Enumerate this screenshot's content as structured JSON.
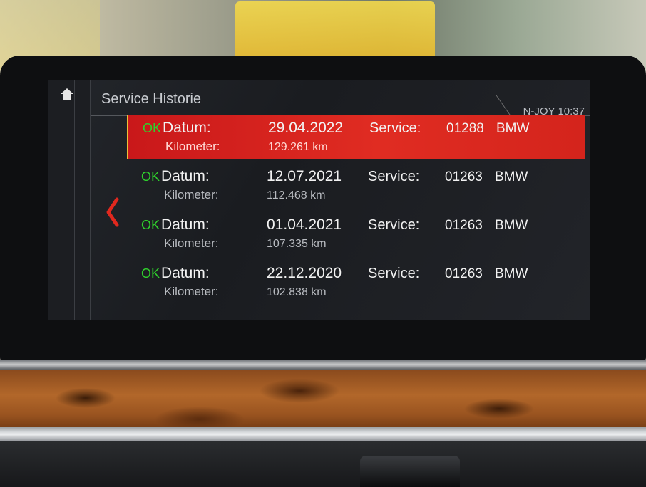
{
  "screen": {
    "title": "Service Historie",
    "status": "N-JOY 10:37"
  },
  "labels": {
    "ok": "OK",
    "datum": "Datum:",
    "kilometer": "Kilometer:",
    "service": "Service:"
  },
  "entries": [
    {
      "date": "29.04.2022",
      "km": "129.261 km",
      "service_no": "01288",
      "brand": "BMW",
      "selected": true
    },
    {
      "date": "12.07.2021",
      "km": "112.468 km",
      "service_no": "01263",
      "brand": "BMW",
      "selected": false
    },
    {
      "date": "01.04.2021",
      "km": "107.335 km",
      "service_no": "01263",
      "brand": "BMW",
      "selected": false
    },
    {
      "date": "22.12.2020",
      "km": "102.838 km",
      "service_no": "01263",
      "brand": "BMW",
      "selected": false
    }
  ],
  "icons": {
    "home": "home-icon",
    "back": "chevron-left-icon"
  },
  "colors": {
    "selection": "#d42420",
    "ok": "#2fd12c",
    "back_arrow": "#e0281e"
  }
}
